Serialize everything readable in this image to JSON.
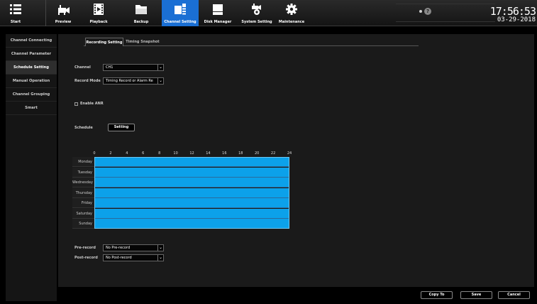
{
  "toolbar": {
    "items": [
      {
        "label": "Start",
        "icon": "menu-icon"
      },
      {
        "label": "Preview",
        "icon": "camera-icon"
      },
      {
        "label": "Playback",
        "icon": "film-icon"
      },
      {
        "label": "Backup",
        "icon": "folder-icon"
      },
      {
        "label": "Channel Setting",
        "icon": "channel-setting-icon",
        "active": true
      },
      {
        "label": "Disk Manager",
        "icon": "disk-icon"
      },
      {
        "label": "System Setting",
        "icon": "camera-gear-icon"
      },
      {
        "label": "Maintenance",
        "icon": "gear-icon"
      }
    ],
    "status_question": "?",
    "clock_time": "17:56:53",
    "clock_date": "03-29-2018"
  },
  "sidebar": {
    "items": [
      {
        "label": "Channel Connecting"
      },
      {
        "label": "Channel Parameter"
      },
      {
        "label": "Schedule Setting",
        "active": true
      },
      {
        "label": "Manual Operation"
      },
      {
        "label": "Channel Grouping"
      },
      {
        "label": "Smart"
      }
    ]
  },
  "tabs": [
    {
      "label": "Recording Setting",
      "active": true
    },
    {
      "label": "Timing Snapshot"
    }
  ],
  "form": {
    "channel_label": "Channel",
    "channel_value": "CH1",
    "record_mode_label": "Record Mode",
    "record_mode_value": "Timing Record or Alarm Re",
    "enable_anr_label": "Enable ANR",
    "enable_anr_checked": false,
    "schedule_label": "Schedule",
    "setting_button": "Setting",
    "pre_record_label": "Pre-record",
    "pre_record_value": "No Pre-record",
    "post_record_label": "Post-record",
    "post_record_value": "No Post-record"
  },
  "schedule": {
    "hours": [
      "0",
      "2",
      "4",
      "6",
      "8",
      "10",
      "12",
      "14",
      "16",
      "18",
      "20",
      "22",
      "24"
    ],
    "days": [
      "Monday",
      "Tuesday",
      "Wednesday",
      "Thursday",
      "Friday",
      "Saturday",
      "Sunday"
    ],
    "fill_color": "#0ca1ea"
  },
  "footer": {
    "copy_to": "Copy To",
    "save": "Save",
    "cancel": "Cancel"
  },
  "colors": {
    "accent": "#1a6fd4",
    "schedule_blue": "#0ca1ea"
  }
}
